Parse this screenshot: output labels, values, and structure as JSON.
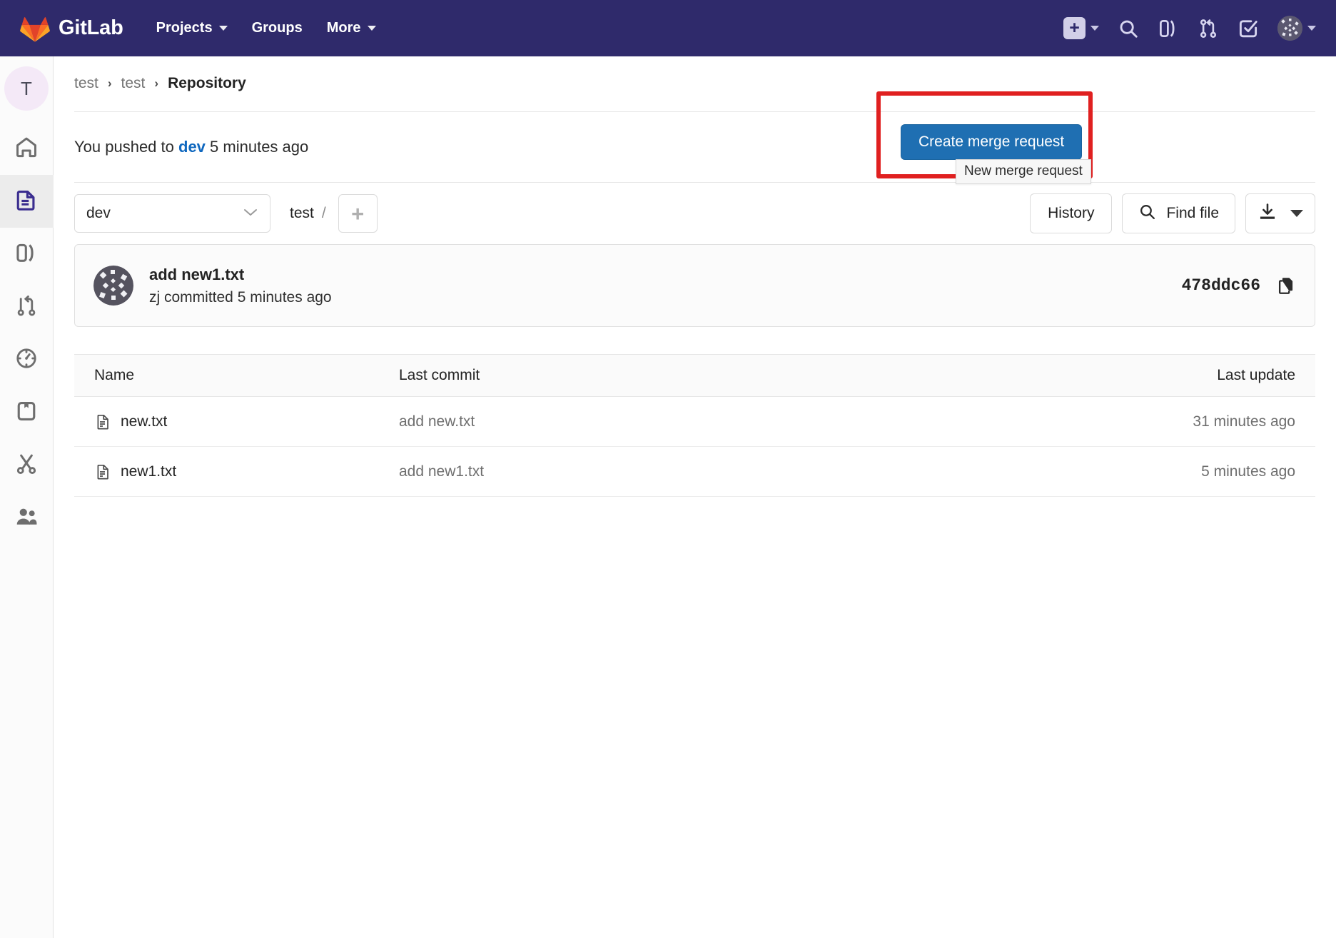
{
  "navbar": {
    "brand": "GitLab",
    "links": [
      {
        "label": "Projects",
        "has_caret": true
      },
      {
        "label": "Groups",
        "has_caret": false
      },
      {
        "label": "More",
        "has_caret": true
      }
    ],
    "icons": [
      "plus-icon",
      "search-icon",
      "issues-icon",
      "merge-requests-icon",
      "todos-icon",
      "user-avatar"
    ]
  },
  "sidebar": {
    "avatar_letter": "T",
    "items": [
      {
        "name": "project-home",
        "icon": "home-icon",
        "active": false
      },
      {
        "name": "repository",
        "icon": "document-icon",
        "active": true
      },
      {
        "name": "issues",
        "icon": "issues-icon",
        "active": false
      },
      {
        "name": "merge-requests",
        "icon": "merge-request-icon",
        "active": false
      },
      {
        "name": "ci-cd",
        "icon": "rocket-gauge-icon",
        "active": false
      },
      {
        "name": "packages",
        "icon": "package-icon",
        "active": false
      },
      {
        "name": "snippets",
        "icon": "scissors-icon",
        "active": false
      },
      {
        "name": "members",
        "icon": "users-icon",
        "active": false
      }
    ]
  },
  "breadcrumb": {
    "items": [
      "test",
      "test"
    ],
    "current": "Repository",
    "separator": "›"
  },
  "push_banner": {
    "prefix": "You pushed to",
    "branch": "dev",
    "suffix": "5 minutes ago",
    "button_label": "Create merge request",
    "tooltip": "New merge request",
    "highlight_color": "#e02020",
    "button_color": "#1f6fb2"
  },
  "toolbar": {
    "branch": "dev",
    "path_root": "test",
    "path_separator": "/",
    "add_label": "+",
    "history_label": "History",
    "find_file_label": "Find file",
    "download_icon": "download-icon"
  },
  "commit": {
    "title": "add new1.txt",
    "author_line": "zj committed 5 minutes ago",
    "sha": "478ddc66",
    "copy_icon": "copy-icon"
  },
  "file_table": {
    "columns": [
      "Name",
      "Last commit",
      "Last update"
    ],
    "rows": [
      {
        "name": "new.txt",
        "last_commit": "add new.txt",
        "last_update": "31 minutes ago"
      },
      {
        "name": "new1.txt",
        "last_commit": "add new1.txt",
        "last_update": "5 minutes ago"
      }
    ]
  }
}
